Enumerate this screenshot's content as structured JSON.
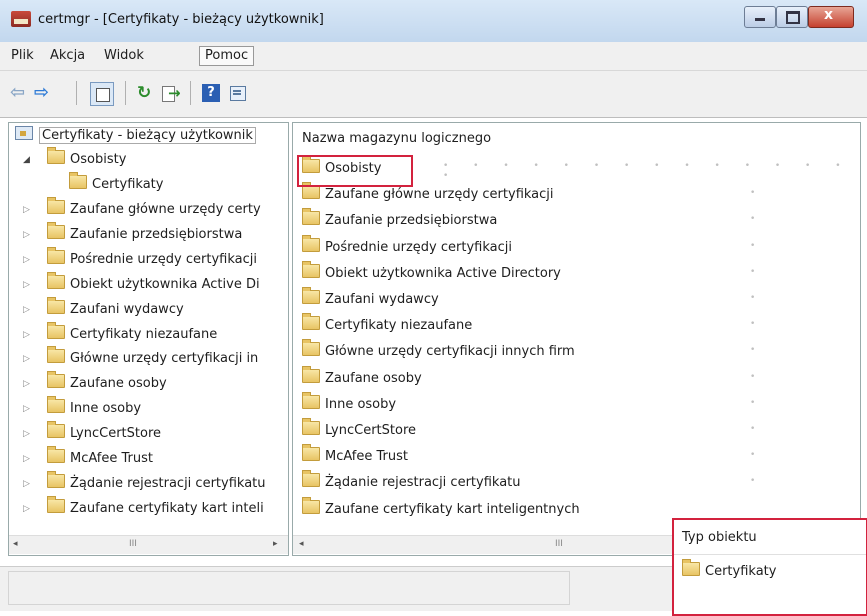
{
  "window": {
    "title": "certmgr - [Certyfikaty - bieżący użytkownik]",
    "min_glyph": "",
    "max_glyph": "",
    "close_glyph": "x"
  },
  "menu": {
    "items": [
      "Plik",
      "Akcja",
      "Widok",
      "Pomoc"
    ]
  },
  "toolbar": {
    "icons": [
      "back-arrow-icon",
      "forward-arrow-icon",
      "show-hide-tree-icon",
      "refresh-icon",
      "export-list-icon",
      "help-icon",
      "properties-icon"
    ],
    "back": "⇦",
    "forward": "⇨",
    "refresh": "↻",
    "help": "?"
  },
  "tree": {
    "root": "Certyfikaty - bieżący użytkownik",
    "expanded_glyph": "◢",
    "collapsed_glyph": "▷",
    "osobisty": "Osobisty",
    "osobisty_child": "Certyfikaty",
    "items": [
      "Zaufane główne urzędy certy",
      "Zaufanie przedsiębiorstwa",
      "Pośrednie urzędy certyfikacji",
      "Obiekt użytkownika Active Di",
      "Zaufani wydawcy",
      "Certyfikaty niezaufane",
      "Główne urzędy certyfikacji in",
      "Zaufane osoby",
      "Inne osoby",
      "LyncCertStore",
      "McAfee Trust",
      "Żądanie rejestracji certyfikatu",
      "Zaufane certyfikaty kart inteli"
    ]
  },
  "list": {
    "column_header": "Nazwa magazynu logicznego",
    "items": [
      "Osobisty",
      "Zaufane główne urzędy certyfikacji",
      "Zaufanie przedsiębiorstwa",
      "Pośrednie urzędy certyfikacji",
      "Obiekt użytkownika Active Directory",
      "Zaufani wydawcy",
      "Certyfikaty niezaufane",
      "Główne urzędy certyfikacji innych firm",
      "Zaufane osoby",
      "Inne osoby",
      "LyncCertStore",
      "McAfee Trust",
      "Żądanie rejestracji certyfikatu",
      "Zaufane certyfikaty kart inteligentnych"
    ],
    "selected_index": 0,
    "highlight_color": "#d3223e"
  },
  "scrollbar": {
    "left": "◂",
    "right": "▸",
    "thumb": "III"
  },
  "callout": {
    "column_header": "Typ obiektu",
    "item": "Certyfikaty"
  }
}
